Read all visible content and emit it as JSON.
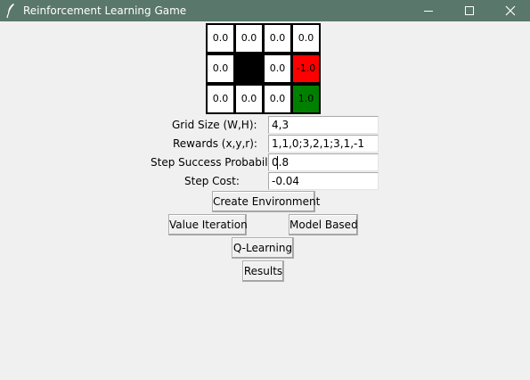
{
  "window": {
    "title": "Reinforcement Learning Game",
    "minimize_glyph": "minimize-icon",
    "maximize_glyph": "maximize-icon",
    "close_glyph": "close-icon",
    "titlebar_color": "#59776a"
  },
  "grid": {
    "columns": 4,
    "rows": 3,
    "cells": [
      [
        "0.0",
        "0.0",
        "0.0",
        "0.0"
      ],
      [
        "0.0",
        "",
        "0.0",
        "-1.0"
      ],
      [
        "0.0",
        "0.0",
        "0.0",
        "1.0"
      ]
    ],
    "colors": {
      "empty": "#ffffff",
      "wall": "#000000",
      "negative": "#ff0000",
      "positive": "#008000"
    }
  },
  "form": {
    "grid_size_label": "Grid Size (W,H):",
    "grid_size_value": "4,3",
    "rewards_label": "Rewards (x,y,r):",
    "rewards_value": "1,1,0;3,2,1;3,1,-1",
    "step_prob_label": "Step Success Probability:",
    "step_prob_value": "0.8",
    "step_cost_label": "Step Cost:",
    "step_cost_value": "-0.04"
  },
  "buttons": {
    "create_env": "Create Environment",
    "value_iteration": "Value Iteration",
    "model_based": "Model Based",
    "q_learning": "Q-Learning",
    "results": "Results"
  }
}
